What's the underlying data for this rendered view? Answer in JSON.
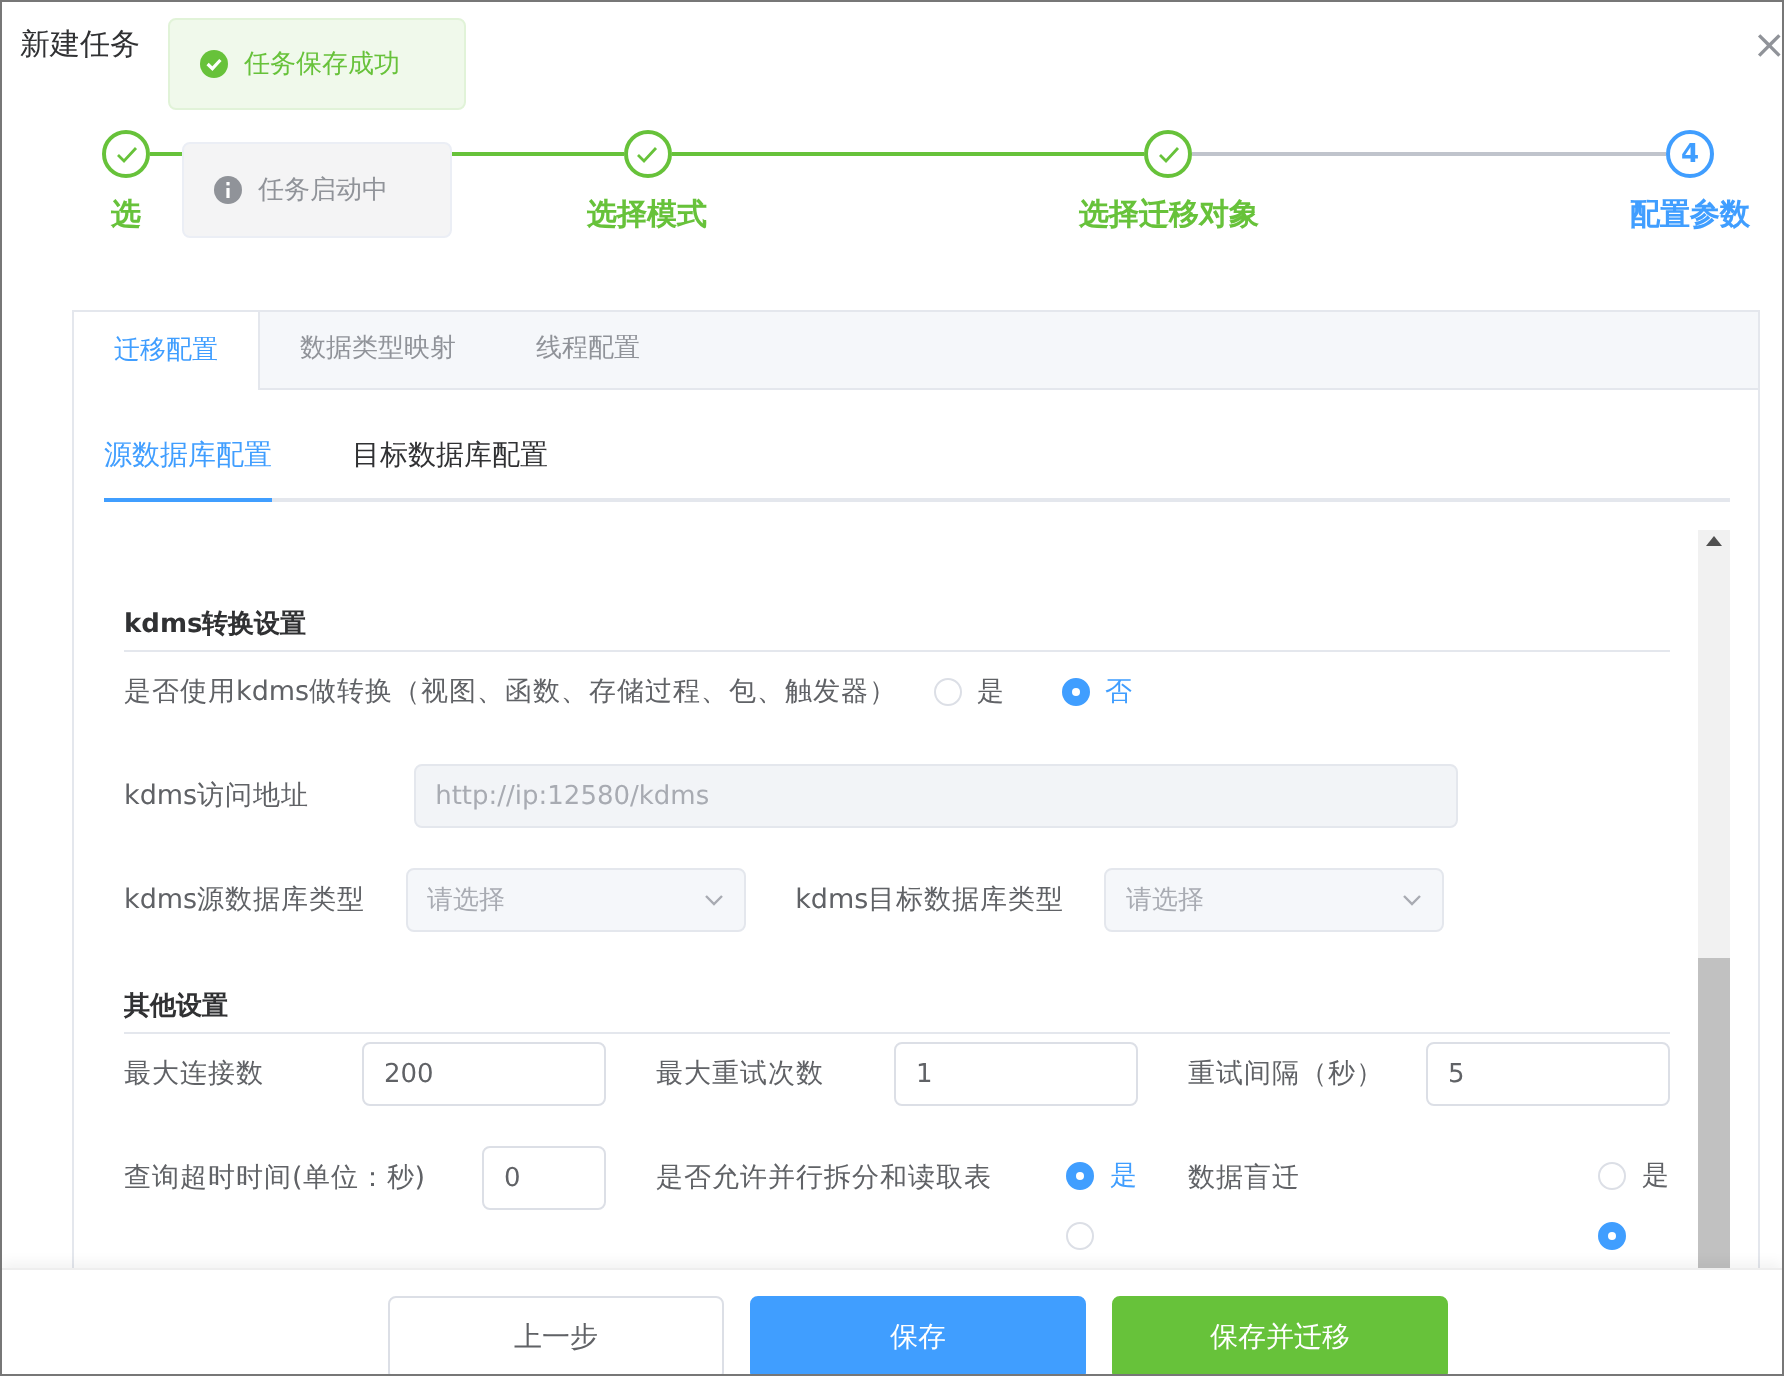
{
  "dialog": {
    "title": "新建任务",
    "close": "×"
  },
  "toasts": [
    {
      "kind": "success",
      "text": "任务保存成功"
    },
    {
      "kind": "info",
      "text": "任务启动中"
    }
  ],
  "steps": [
    {
      "label": "选",
      "done": true
    },
    {
      "label": "选择模式",
      "done": true
    },
    {
      "label": "选择迁移对象",
      "done": true
    },
    {
      "label": "配置参数",
      "done": false,
      "number": "4"
    }
  ],
  "tabs": [
    {
      "label": "迁移配置",
      "selected": true
    },
    {
      "label": "数据类型映射",
      "selected": false
    },
    {
      "label": "线程配置",
      "selected": false
    }
  ],
  "subtabs": [
    {
      "label": "源数据库配置",
      "selected": true
    },
    {
      "label": "目标数据库配置",
      "selected": false
    }
  ],
  "sections": [
    {
      "title": "kdms转换设置",
      "rows": [
        [
          {
            "kind": "radio",
            "label": "是否使用kdms做转换（视图、函数、存储过程、包、触发器）",
            "options": [
              {
                "label": "是",
                "selected": false
              },
              {
                "label": "否",
                "selected": true
              }
            ]
          }
        ],
        [
          {
            "kind": "input",
            "label": "kdms访问地址",
            "placeholder": "http://ip:12580/kdms",
            "disabled": true
          }
        ],
        [
          {
            "kind": "select",
            "label": "kdms源数据库类型",
            "placeholder": "请选择",
            "disabled": true
          },
          {
            "kind": "select",
            "label": "kdms目标数据库类型",
            "placeholder": "请选择",
            "disabled": true
          }
        ]
      ]
    },
    {
      "title": "其他设置",
      "rows": [
        [
          {
            "kind": "input",
            "label": "最大连接数",
            "value": "200",
            "disabled": false
          },
          {
            "kind": "input",
            "label": "最大重试次数",
            "value": "1",
            "disabled": false
          },
          {
            "kind": "input",
            "label": "重试间隔（秒）",
            "value": "5",
            "disabled": false
          }
        ],
        [
          {
            "kind": "input",
            "label": "查询超时时间(单位：秒)",
            "value": "0",
            "disabled": false
          },
          {
            "kind": "radio",
            "label": "是否允许并行拆分和读取表",
            "options": [
              {
                "label": "是",
                "selected": true
              },
              {
                "selected": false
              }
            ]
          },
          {
            "kind": "radio",
            "label": "数据盲迁",
            "options": [
              {
                "label": "是",
                "selected": false
              },
              {
                "selected": true
              }
            ]
          }
        ]
      ]
    }
  ],
  "buttons": [
    {
      "label": "上一步",
      "kind": "default"
    },
    {
      "label": "保存",
      "kind": "primary"
    },
    {
      "label": "保存并迁移",
      "kind": "success"
    }
  ]
}
